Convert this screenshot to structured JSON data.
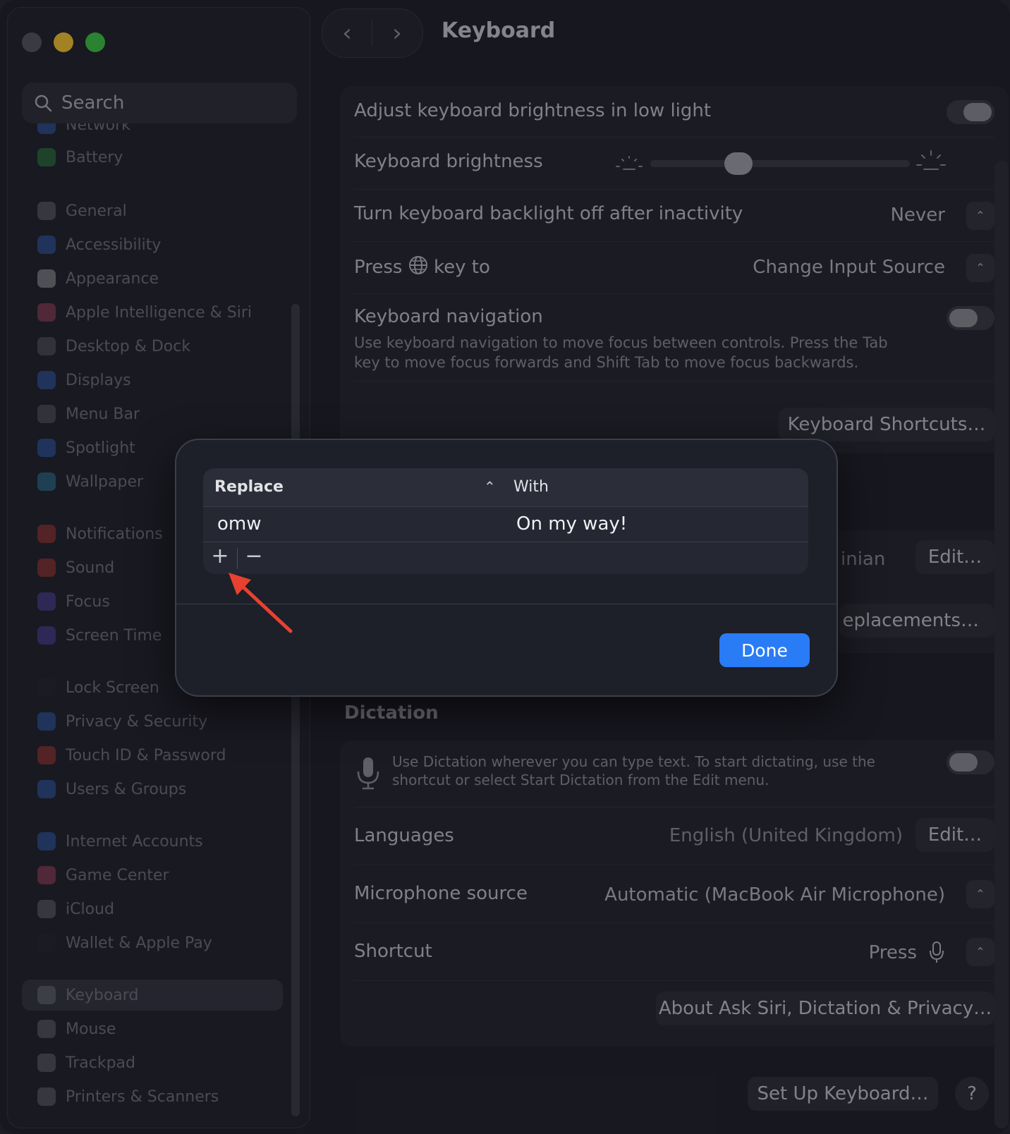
{
  "window": {
    "title": "Keyboard",
    "traffic_colors": [
      "#55565d",
      "#f4c32f",
      "#3ec444"
    ]
  },
  "sidebar": {
    "search_placeholder": "Search",
    "items": [
      {
        "label": "Network",
        "icon": "network-icon",
        "color": "#3a7cf0"
      },
      {
        "label": "Battery",
        "icon": "battery-icon",
        "color": "#36b24a"
      },
      {
        "label": "General",
        "icon": "gear-icon",
        "color": "#8a8b93"
      },
      {
        "label": "Accessibility",
        "icon": "accessibility-icon",
        "color": "#3a7cf0"
      },
      {
        "label": "Appearance",
        "icon": "appearance-icon",
        "color": "#dddddd"
      },
      {
        "label": "Apple Intelligence & Siri",
        "icon": "siri-icon",
        "color": "#e0567a"
      },
      {
        "label": "Desktop & Dock",
        "icon": "dock-icon",
        "color": "#777883"
      },
      {
        "label": "Displays",
        "icon": "displays-icon",
        "color": "#3a7cf0"
      },
      {
        "label": "Menu Bar",
        "icon": "menubar-icon",
        "color": "#777883"
      },
      {
        "label": "Spotlight",
        "icon": "spotlight-icon",
        "color": "#3a7cf0"
      },
      {
        "label": "Wallpaper",
        "icon": "wallpaper-icon",
        "color": "#3aa6d8"
      },
      {
        "label": "Notifications",
        "icon": "notifications-icon",
        "color": "#e8443a"
      },
      {
        "label": "Sound",
        "icon": "sound-icon",
        "color": "#e8443a"
      },
      {
        "label": "Focus",
        "icon": "focus-icon",
        "color": "#6a55e0"
      },
      {
        "label": "Screen Time",
        "icon": "screentime-icon",
        "color": "#6a55e0"
      },
      {
        "label": "Lock Screen",
        "icon": "lock-icon",
        "color": "#2a2b33"
      },
      {
        "label": "Privacy & Security",
        "icon": "privacy-icon",
        "color": "#3a7cf0"
      },
      {
        "label": "Touch ID & Password",
        "icon": "touchid-icon",
        "color": "#e8443a"
      },
      {
        "label": "Users & Groups",
        "icon": "users-icon",
        "color": "#3a7cf0"
      },
      {
        "label": "Internet Accounts",
        "icon": "internet-accounts-icon",
        "color": "#3a7cf0"
      },
      {
        "label": "Game Center",
        "icon": "gamecenter-icon",
        "color": "#e0567a"
      },
      {
        "label": "iCloud",
        "icon": "icloud-icon",
        "color": "#8a8b93"
      },
      {
        "label": "Wallet & Apple Pay",
        "icon": "wallet-icon",
        "color": "#2a2b33"
      },
      {
        "label": "Keyboard",
        "icon": "keyboard-icon",
        "color": "#8a8b93",
        "active": true
      },
      {
        "label": "Mouse",
        "icon": "mouse-icon",
        "color": "#8a8b93"
      },
      {
        "label": "Trackpad",
        "icon": "trackpad-icon",
        "color": "#8a8b93"
      },
      {
        "label": "Printers & Scanners",
        "icon": "printer-icon",
        "color": "#8a8b93"
      }
    ]
  },
  "main": {
    "brightness_adjust_label": "Adjust keyboard brightness in low light",
    "brightness_label": "Keyboard brightness",
    "brightness_level": 0.32,
    "backlight_label": "Turn keyboard backlight off after inactivity",
    "backlight_value": "Never",
    "press_key_label_1": "Press",
    "press_key_label_2": "key to",
    "press_key_value": "Change Input Source",
    "nav_label": "Keyboard navigation",
    "nav_desc_1": "Use keyboard navigation to move focus between controls. Press the Tab",
    "nav_desc_2": "key to move focus forwards and Shift Tab to move focus backwards.",
    "shortcuts_button": "Keyboard Shortcuts…",
    "input_partial": "inian",
    "input_edit": "Edit…",
    "replacements_partial": "eplacements…",
    "dictation_title": "Dictation",
    "dictation_desc_1": "Use Dictation wherever you can type text. To start dictating, use the",
    "dictation_desc_2": "shortcut or select Start Dictation from the Edit menu.",
    "languages_label": "Languages",
    "languages_value": "English (United Kingdom)",
    "languages_edit": "Edit…",
    "mic_label": "Microphone source",
    "mic_value": "Automatic (MacBook Air Microphone)",
    "shortcut_label": "Shortcut",
    "shortcut_value": "Press",
    "about_button": "About Ask Siri, Dictation & Privacy…",
    "setup_button": "Set Up Keyboard…",
    "help_button": "?"
  },
  "sheet": {
    "col_replace": "Replace",
    "col_with": "With",
    "rows": [
      {
        "replace": "omw",
        "with": "On my way!"
      }
    ],
    "add": "+",
    "remove": "−",
    "done": "Done",
    "arrow_color": "#e8412f"
  }
}
